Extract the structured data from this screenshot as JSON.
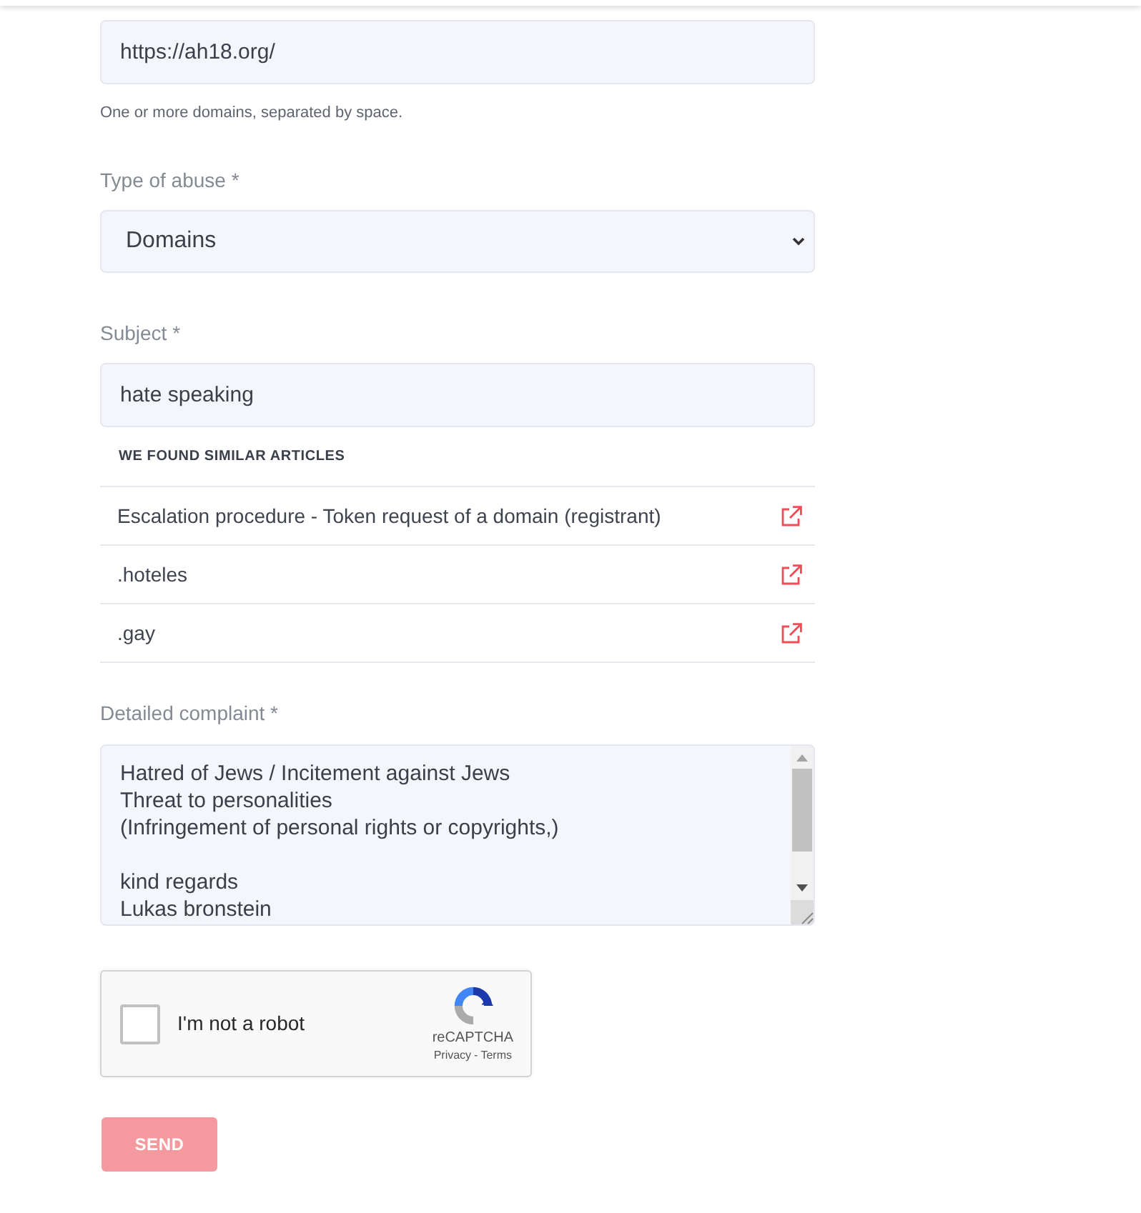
{
  "domains_field": {
    "value": "https://ah18.org/",
    "hint": "One or more domains, separated by space."
  },
  "abuse_type": {
    "label": "Type of abuse *",
    "value": "Domains"
  },
  "subject": {
    "label": "Subject *",
    "value": "hate speaking"
  },
  "similar_articles": {
    "heading": "WE FOUND SIMILAR ARTICLES",
    "items": [
      {
        "title": "Escalation procedure - Token request of a domain (registrant)"
      },
      {
        "title": ".hoteles"
      },
      {
        "title": ".gay"
      }
    ]
  },
  "complaint": {
    "label": "Detailed complaint *",
    "value": "Hatred of Jews / Incitement against Jews\nThreat to personalities\n(Infringement of personal rights or copyrights,)\n\nkind regards\nLukas bronstein"
  },
  "captcha": {
    "label": "I'm not a robot",
    "checked": false,
    "brand": "reCAPTCHA",
    "privacy_link": "Privacy",
    "separator": "-",
    "terms_link": "Terms"
  },
  "send_button": {
    "label": "SEND",
    "disabled": true
  }
}
